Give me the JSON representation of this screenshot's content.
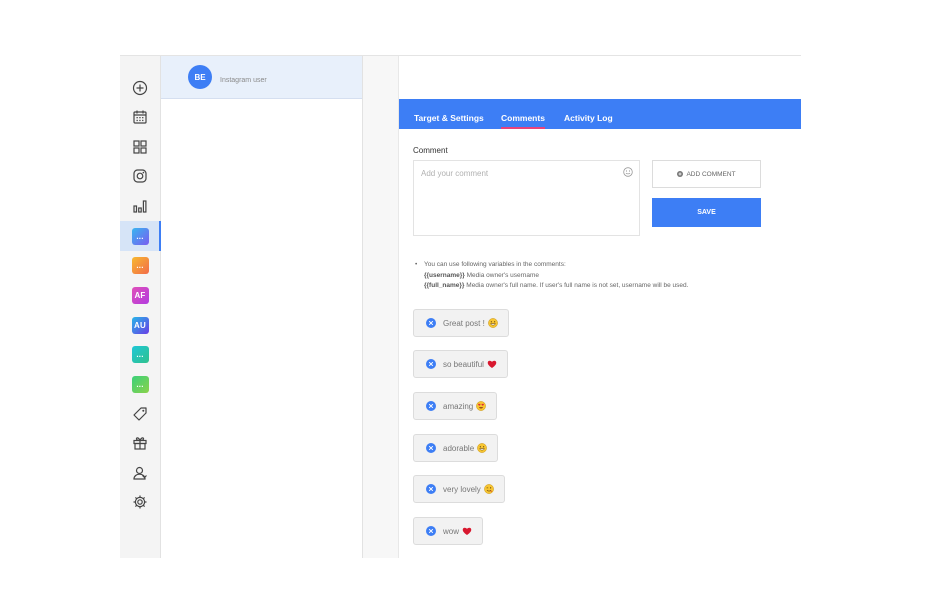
{
  "account": {
    "avatar_initials": "BE",
    "label": "Instagram user"
  },
  "rail": {
    "top_icons": [
      "add-icon",
      "calendar-icon",
      "grid-icon",
      "instagram-icon",
      "stats-icon"
    ],
    "badges": [
      {
        "text": "...",
        "color": "#5b8ef7",
        "active": true
      },
      {
        "text": "...",
        "color": "#f58a2b",
        "active": false
      },
      {
        "text": "AF",
        "color": "#c53ccf",
        "active": false
      },
      {
        "text": "AU",
        "color": "#4a57e8",
        "active": false
      },
      {
        "text": "...",
        "color": "#22c3b8",
        "active": false
      },
      {
        "text": "...",
        "color": "#4bc26b",
        "active": false
      }
    ],
    "bottom_icons": [
      "tag-icon",
      "gift-icon",
      "user-icon",
      "settings-icon"
    ]
  },
  "tabs": [
    {
      "label": "Target & Settings",
      "active": false
    },
    {
      "label": "Comments",
      "active": true
    },
    {
      "label": "Activity Log",
      "active": false
    }
  ],
  "form": {
    "label": "Comment",
    "placeholder": "Add your comment",
    "add_button": "ADD COMMENT",
    "save_button": "SAVE"
  },
  "help": {
    "intro": "You can use following variables in the comments:",
    "vars": [
      {
        "name": "{{username}}",
        "desc": " Media owner's username"
      },
      {
        "name": "{{full_name}}",
        "desc": " Media owner's full name. If user's full name is not set, username will be used."
      }
    ]
  },
  "comments": [
    {
      "text": "Great post !",
      "emoji": "grinning"
    },
    {
      "text": "so beautiful",
      "emoji": "heart"
    },
    {
      "text": "amazing",
      "emoji": "heart-eyes"
    },
    {
      "text": "adorable",
      "emoji": "grinning"
    },
    {
      "text": "very lovely",
      "emoji": "wink"
    },
    {
      "text": "wow",
      "emoji": "heart"
    }
  ],
  "colors": {
    "accent": "#3d7ef5",
    "tab_underline": "#e8437b"
  }
}
